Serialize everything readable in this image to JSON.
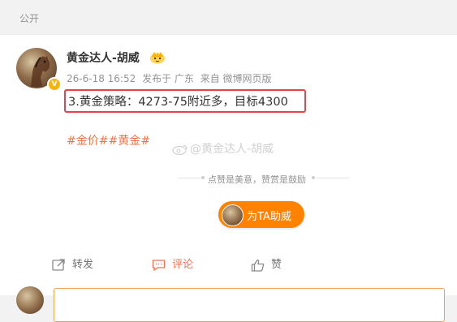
{
  "header": {
    "visibility": "公开"
  },
  "post": {
    "author": "黄金达人-胡威",
    "verified_badge": "V",
    "time": "26-6-18 16:52",
    "location": "发布于 广东",
    "source": "来自 微博网页版",
    "text": "3.黄金策略：4273-75附近多，目标4300",
    "tags": "#金价##黄金#",
    "watermark": "@黄金达人-胡威",
    "reward_prompt": "点赞是美意，赞赏是鼓励",
    "tip_button": "为TA助威",
    "icons": {
      "crown": "crown-icon",
      "verified": "verified-badge-icon",
      "weibo": "weibo-logo-icon"
    }
  },
  "actions": {
    "repost": "转发",
    "comment": "评论",
    "like": "赞"
  },
  "colors": {
    "accent": "#eb7350",
    "tip_button": "#ff8200",
    "highlight_box": "#e8414a",
    "badge": "#f6b40e"
  }
}
